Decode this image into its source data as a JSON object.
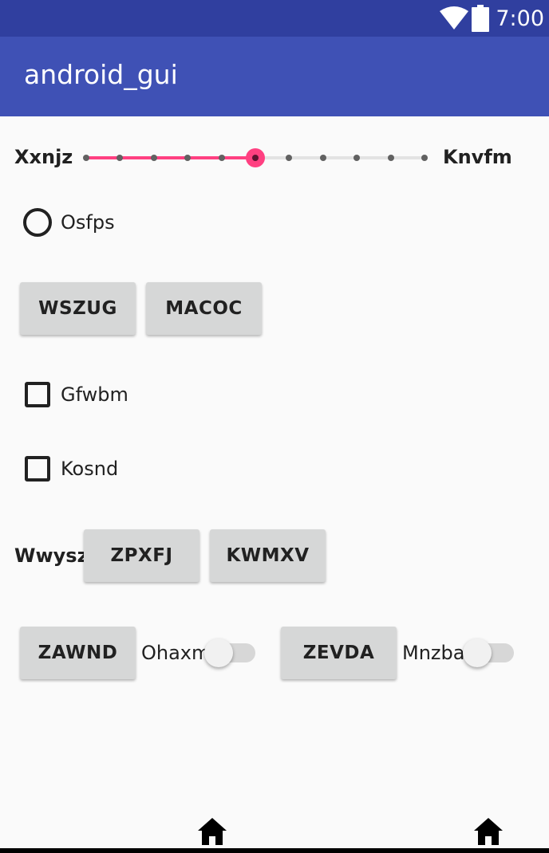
{
  "status_bar": {
    "time": "7:00",
    "icons": [
      "wifi-icon",
      "battery-icon"
    ]
  },
  "app_bar": {
    "title": "android_gui"
  },
  "seekbar": {
    "start_label": "Xxnjz",
    "end_label": "Knvfm",
    "max": 10,
    "progress": 5
  },
  "radio": {
    "label": "Osfps",
    "checked": false
  },
  "button_row_1": {
    "buttons": [
      "WSZUG",
      "MACOC"
    ]
  },
  "checkboxes": [
    {
      "label": "Gfwbm",
      "checked": false
    },
    {
      "label": "Kosnd",
      "checked": false
    }
  ],
  "button_row_2": {
    "label": "Wwysz",
    "buttons": [
      "ZPXFJ",
      "KWMXV"
    ]
  },
  "button_row_3": {
    "left_button": "ZAWND",
    "left_switch": {
      "label": "Ohaxm",
      "on": false
    },
    "right_button": "ZEVDA",
    "right_switch": {
      "label": "Mnzba",
      "on": false
    }
  },
  "bottom_icons": [
    "home-icon",
    "home-icon"
  ],
  "colors": {
    "status_bar": "#303f9f",
    "app_bar": "#3f51b5",
    "accent": "#ff4081",
    "background": "#fafafa",
    "button": "#d6d7d7"
  }
}
